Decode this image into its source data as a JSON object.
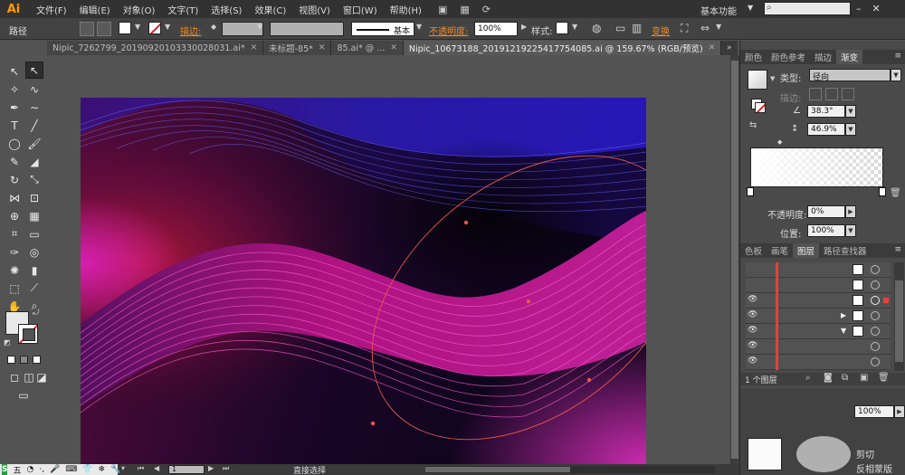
{
  "app": {
    "logo": "Ai"
  },
  "menu": [
    "文件(F)",
    "编辑(E)",
    "对象(O)",
    "文字(T)",
    "选择(S)",
    "效果(C)",
    "视图(V)",
    "窗口(W)",
    "帮助(H)"
  ],
  "workspace": "基本功能",
  "control": {
    "path_label": "路径",
    "stroke_label": "描边:",
    "stroke_style": "基本",
    "opacity_label": "不透明度:",
    "opacity_value": "100%",
    "style_label": "样式:",
    "transform_label": "变换"
  },
  "tabs": [
    {
      "label": "Nipic_7262799_20190920103330028031.ai*",
      "active": false
    },
    {
      "label": "未标题-85*",
      "active": false
    },
    {
      "label": "85.ai* @ ...",
      "active": false
    },
    {
      "label": "Nipic_10673188_20191219225417754085.ai @ 159.67% (RGB/预览)",
      "active": true
    }
  ],
  "panels": {
    "top_tabs": [
      "颜色",
      "颜色参考",
      "描边",
      "渐变"
    ],
    "active_top_tab": "渐变",
    "gradient": {
      "type_label": "类型:",
      "type_value": "径向",
      "stroke_label": "描边:",
      "angle_value": "38.3°",
      "ratio_value": "46.9%",
      "opacity_label": "不透明度:",
      "opacity_value": "0%",
      "position_label": "位置:",
      "position_value": "100%"
    },
    "bottom_tabs": [
      "色板",
      "画笔",
      "图层",
      "路径查找器"
    ],
    "active_bottom_tab": "图层",
    "layer_count": "1 个图层",
    "extra": {
      "zoom_value": "100%",
      "label_1": "剪切",
      "label_2": "反相蒙版"
    }
  },
  "status": {
    "ime": [
      "五",
      "◔",
      "·,",
      "🎤",
      "⌨",
      "👕",
      "❄",
      "🔧"
    ],
    "page": "1",
    "tool": "直接选择"
  },
  "colors": {
    "accent": "#f08a24",
    "selection": "#e4433a",
    "path": "#e8564a"
  }
}
